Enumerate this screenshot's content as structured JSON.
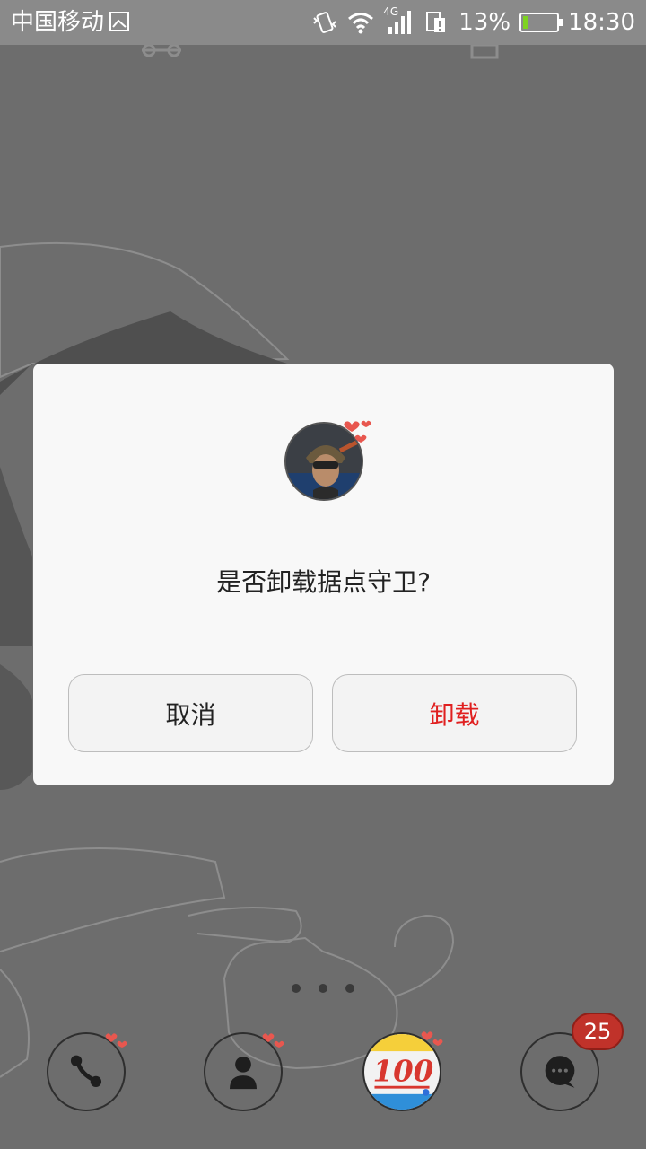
{
  "status_bar": {
    "carrier": "中国移动",
    "network": "4G",
    "battery_percent": "13%",
    "time": "18:30"
  },
  "dialog": {
    "message": "是否卸载据点守卫?",
    "cancel_label": "取消",
    "uninstall_label": "卸载",
    "app_icon": "game-avatar-icon"
  },
  "dock": {
    "items": [
      {
        "name": "phone",
        "icon": "phone-icon"
      },
      {
        "name": "contacts",
        "icon": "contacts-icon"
      },
      {
        "name": "app",
        "icon": "score-100-icon"
      },
      {
        "name": "messages",
        "icon": "message-icon"
      }
    ],
    "messages_badge": "25"
  },
  "colors": {
    "accent_red": "#e02020",
    "battery_green": "#7ed321",
    "overlay": "#6d6d6d"
  }
}
